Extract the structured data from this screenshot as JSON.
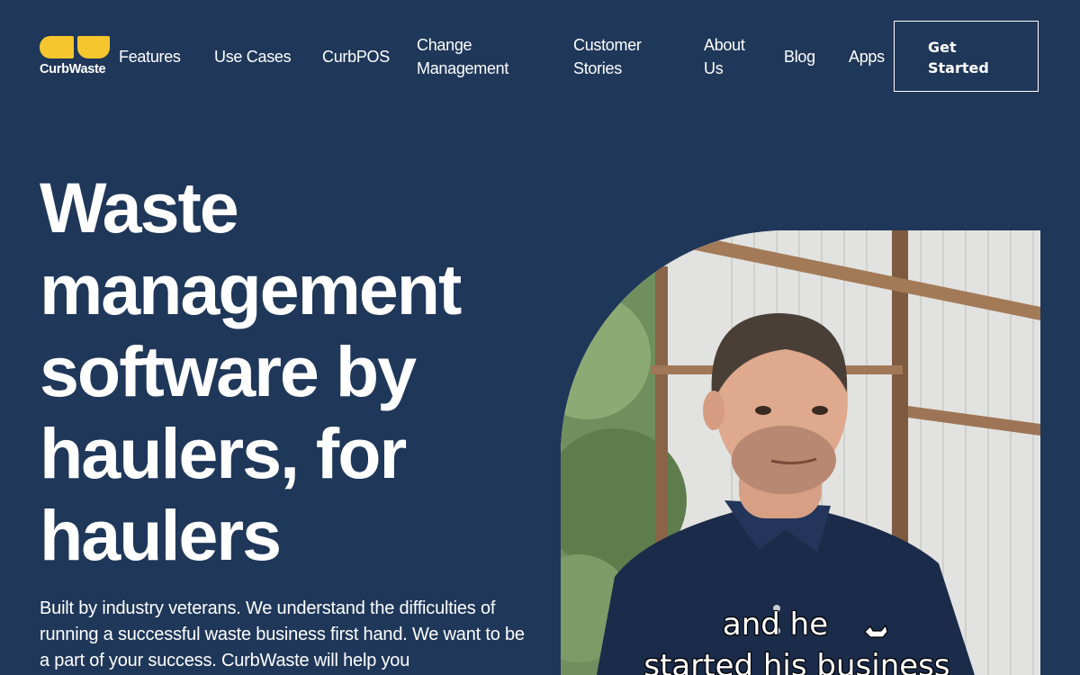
{
  "brand": {
    "name": "CurbWaste",
    "logo_color": "#f5c62d"
  },
  "nav": {
    "items": [
      "Features",
      "Use Cases",
      "CurbPOS",
      "Change Management",
      "Customer Stories",
      "About Us",
      "Blog",
      "Apps"
    ],
    "cta_label": "Get Started"
  },
  "hero": {
    "title": "Waste management software by haulers, for haulers",
    "body": "Built by industry veterans. We understand the difficulties of running a successful waste business first hand. We want to be a part of your success. CurbWaste will help you"
  },
  "video": {
    "captions": [
      "and he",
      "started his business"
    ]
  },
  "colors": {
    "background": "#1f3759",
    "text": "#ffffff",
    "accent": "#f5c62d"
  }
}
